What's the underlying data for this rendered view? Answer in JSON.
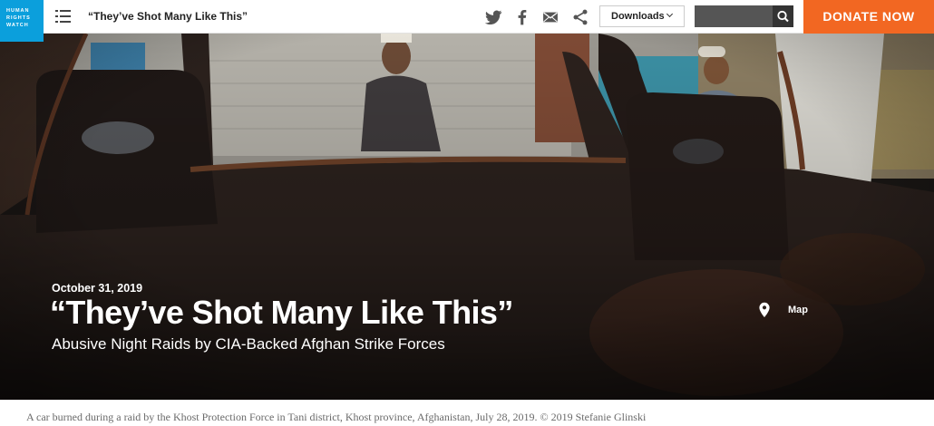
{
  "logo": {
    "lines": [
      "HUMAN",
      "RIGHTS",
      "WATCH"
    ]
  },
  "header": {
    "title": "“They’ve Shot Many Like This”",
    "downloads_label": "Downloads",
    "search_placeholder": "",
    "donate_label": "DONATE NOW",
    "icons": [
      "menu-icon",
      "twitter-icon",
      "facebook-icon",
      "email-icon",
      "share-icon",
      "search-icon"
    ]
  },
  "hero": {
    "date": "October 31, 2019",
    "title": "“They’ve Shot Many Like This”",
    "subtitle": "Abusive Night Raids by CIA-Backed Afghan Strike Forces",
    "map_label": "Map"
  },
  "caption": "A car burned during a raid by the Khost Protection Force in Tani district, Khost province, Afghanistan, July 28, 2019. © 2019 Stefanie Glinski",
  "colors": {
    "logo_bg": "#0b9fdc",
    "donate_bg": "#f26722",
    "search_bg": "#555555",
    "search_button_bg": "#333333",
    "hero_overlay": "#1b1715"
  }
}
